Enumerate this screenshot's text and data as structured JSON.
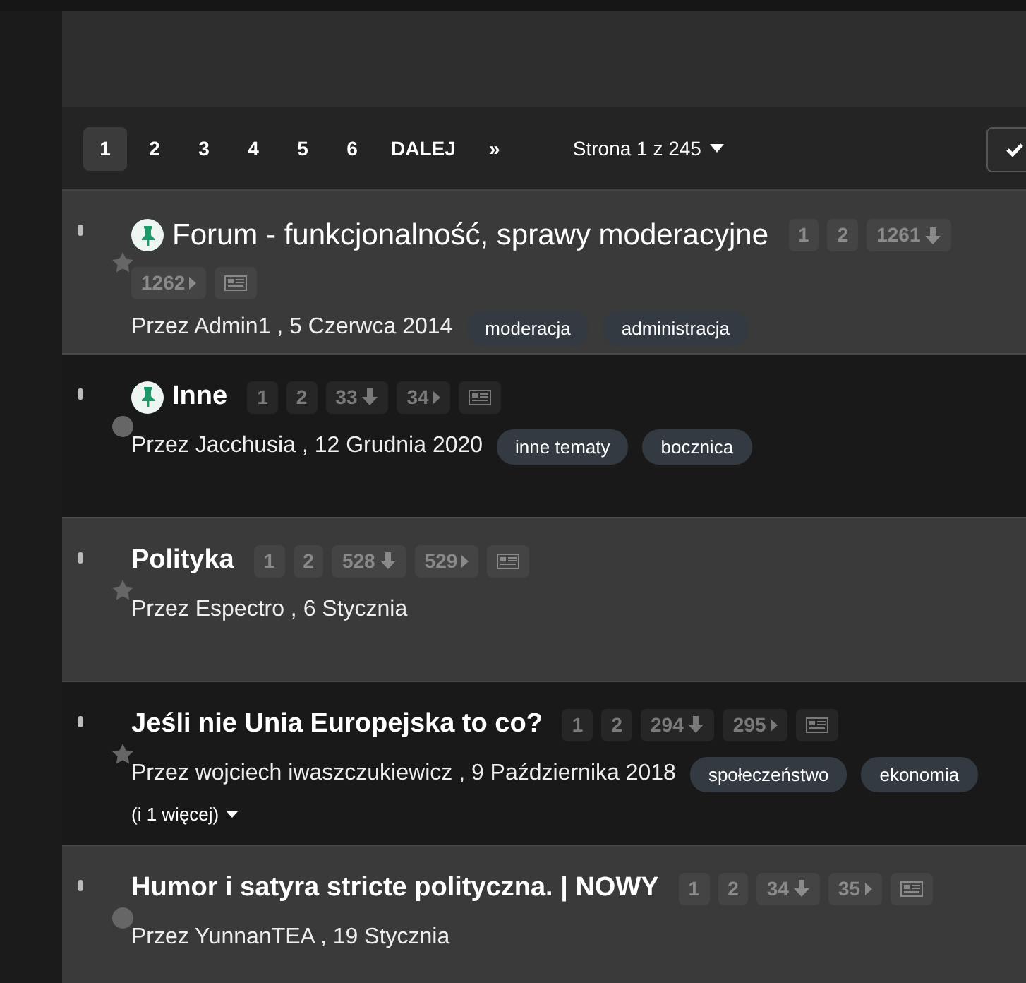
{
  "pagination": {
    "pages": [
      {
        "label": "1",
        "selected": true
      },
      {
        "label": "2",
        "selected": false
      },
      {
        "label": "3",
        "selected": false
      },
      {
        "label": "4",
        "selected": false
      },
      {
        "label": "5",
        "selected": false
      },
      {
        "label": "6",
        "selected": false
      }
    ],
    "next": "DALEJ",
    "last": "»",
    "page_info": "Strona 1 z 245"
  },
  "topics": [
    {
      "title": "Forum - funkcjonalność, sprawy moderacyjne",
      "pinned": true,
      "unread": false,
      "starred": true,
      "pages": [
        {
          "label": "1",
          "kind": "page"
        },
        {
          "label": "2",
          "kind": "page"
        },
        {
          "label": "1261",
          "kind": "unread"
        },
        {
          "label": "1262",
          "kind": "last"
        }
      ],
      "author_line": "Przez Admin1 , 5 Czerwca 2014",
      "tags": [
        "moderacja",
        "administracja"
      ]
    },
    {
      "title": "Inne",
      "pinned": true,
      "unread": true,
      "starred": false,
      "pages": [
        {
          "label": "1",
          "kind": "page"
        },
        {
          "label": "2",
          "kind": "page"
        },
        {
          "label": "33",
          "kind": "unread"
        },
        {
          "label": "34",
          "kind": "last"
        }
      ],
      "author_line": "Przez Jacchusia , 12 Grudnia 2020",
      "tags": [
        "inne tematy",
        "bocznica"
      ]
    },
    {
      "title": "Polityka",
      "pinned": false,
      "unread": true,
      "starred": true,
      "pages": [
        {
          "label": "1",
          "kind": "page"
        },
        {
          "label": "2",
          "kind": "page"
        },
        {
          "label": "528",
          "kind": "unread"
        },
        {
          "label": "529",
          "kind": "last"
        }
      ],
      "author_line": "Przez Espectro , 6 Stycznia"
    },
    {
      "title": "Jeśli nie Unia Europejska to co?",
      "pinned": false,
      "unread": true,
      "starred": true,
      "pages": [
        {
          "label": "1",
          "kind": "page"
        },
        {
          "label": "2",
          "kind": "page"
        },
        {
          "label": "294",
          "kind": "unread"
        },
        {
          "label": "295",
          "kind": "last"
        }
      ],
      "author_line": "Przez wojciech iwaszczukiewicz , 9 Października 2018",
      "tags": [
        "społeczeństwo",
        "ekonomia"
      ],
      "more_tags": "(i 1 więcej)"
    },
    {
      "title": "Humor i satyra stricte polityczna. | NOWY",
      "pinned": false,
      "unread": true,
      "starred": false,
      "pages": [
        {
          "label": "1",
          "kind": "page"
        },
        {
          "label": "2",
          "kind": "page"
        },
        {
          "label": "34",
          "kind": "unread"
        },
        {
          "label": "35",
          "kind": "last"
        }
      ],
      "author_line": "Przez YunnanTEA , 19 Stycznia"
    }
  ]
}
